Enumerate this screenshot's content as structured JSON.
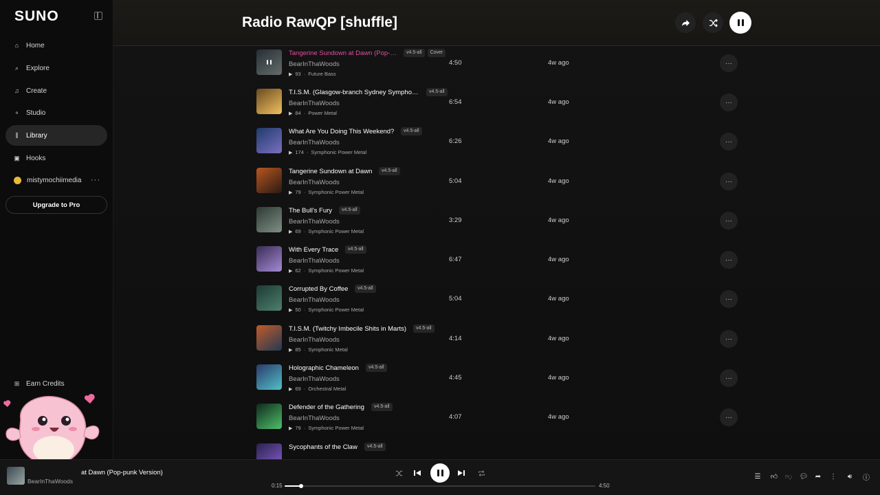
{
  "app": {
    "logo": "SUNO"
  },
  "sidebar": {
    "items": [
      {
        "label": "Home",
        "icon": "home-icon"
      },
      {
        "label": "Explore",
        "icon": "search-icon"
      },
      {
        "label": "Create",
        "icon": "music-note-icon"
      },
      {
        "label": "Studio",
        "icon": "studio-icon"
      },
      {
        "label": "Library",
        "icon": "library-icon",
        "active": true
      },
      {
        "label": "Hooks",
        "icon": "hooks-icon"
      }
    ],
    "user": {
      "name": "mistymochiimedia",
      "more": "···"
    },
    "upgrade_label": "Upgrade to Pro",
    "earn_credits": "Earn Credits"
  },
  "header": {
    "title": "Radio RawQP [shuffle]"
  },
  "songs": [
    {
      "title": "Tangerine Sundown at Dawn (Pop-punk Version)",
      "version": "v4.5-all",
      "tag": "Cover",
      "artist": "BearInThaWoods",
      "plays": "93",
      "genre": "Future Bass",
      "duration": "4:50",
      "ago": "4w ago",
      "playing": true
    },
    {
      "title": "T.I.S.M. (Glasgow-branch Sydney Symphony Orchestra)",
      "version": "v4.5-all",
      "artist": "BearInThaWoods",
      "plays": "84",
      "genre": "Power Metal",
      "duration": "6:54",
      "ago": "4w ago"
    },
    {
      "title": "What Are You Doing This Weekend?",
      "version": "v4.5-all",
      "artist": "BearInThaWoods",
      "plays": "174",
      "genre": "Symphonic Power Metal",
      "duration": "6:26",
      "ago": "4w ago"
    },
    {
      "title": "Tangerine Sundown at Dawn",
      "version": "v4.5-all",
      "artist": "BearInThaWoods",
      "plays": "79",
      "genre": "Symphonic Power Metal",
      "duration": "5:04",
      "ago": "4w ago"
    },
    {
      "title": "The Bull's Fury",
      "version": "v4.5-all",
      "artist": "BearInThaWoods",
      "plays": "69",
      "genre": "Symphonic Power Metal",
      "duration": "3:29",
      "ago": "4w ago"
    },
    {
      "title": "With Every Trace",
      "version": "v4.5-all",
      "artist": "BearInThaWoods",
      "plays": "62",
      "genre": "Symphonic Power Metal",
      "duration": "6:47",
      "ago": "4w ago"
    },
    {
      "title": "Corrupted By Coffee",
      "version": "v4.5-all",
      "artist": "BearInThaWoods",
      "plays": "50",
      "genre": "Symphonic Power Metal",
      "duration": "5:04",
      "ago": "4w ago"
    },
    {
      "title": "T.I.S.M. (Twitchy Imbecile Shits in Marts)",
      "version": "v4.5-all",
      "artist": "BearInThaWoods",
      "plays": "85",
      "genre": "Symphonic Metal",
      "duration": "4:14",
      "ago": "4w ago"
    },
    {
      "title": "Holographic Chameleon",
      "version": "v4.5-all",
      "artist": "BearInThaWoods",
      "plays": "69",
      "genre": "Orchestral Metal",
      "duration": "4:45",
      "ago": "4w ago"
    },
    {
      "title": "Defender of the Gathering",
      "version": "v4.5-all",
      "artist": "BearInThaWoods",
      "plays": "79",
      "genre": "Symphonic Power Metal",
      "duration": "4:07",
      "ago": "4w ago"
    },
    {
      "title": "Sycophants of the Claw",
      "version": "v4.5-all",
      "artist": "",
      "plays": "",
      "genre": "",
      "duration": "",
      "ago": ""
    }
  ],
  "thumb_colors": [
    [
      "#3b4a52",
      "#9aa6a3"
    ],
    [
      "#6b4b1f",
      "#f0c060"
    ],
    [
      "#1f3b6b",
      "#7a6fc0"
    ],
    [
      "#b8561e",
      "#2a1a14"
    ],
    [
      "#2d3a33",
      "#7f8f86"
    ],
    [
      "#3a2c55",
      "#a58bd4"
    ],
    [
      "#1d3a34",
      "#4e7f6c"
    ],
    [
      "#c25a2a",
      "#243a52"
    ],
    [
      "#2a3a6a",
      "#52c0c8"
    ],
    [
      "#0f2a1c",
      "#4fbf6a"
    ],
    [
      "#2a2250",
      "#8a5fd0"
    ]
  ],
  "player": {
    "now_title": "Tangerine Sundown at Dawn (Pop-punk Version)",
    "now_title_visible": "at Dawn (Pop-punk Version)",
    "now_artist": "BearInThaWoods",
    "current_time": "0:15",
    "total_time": "4:50",
    "progress": 0.052
  }
}
